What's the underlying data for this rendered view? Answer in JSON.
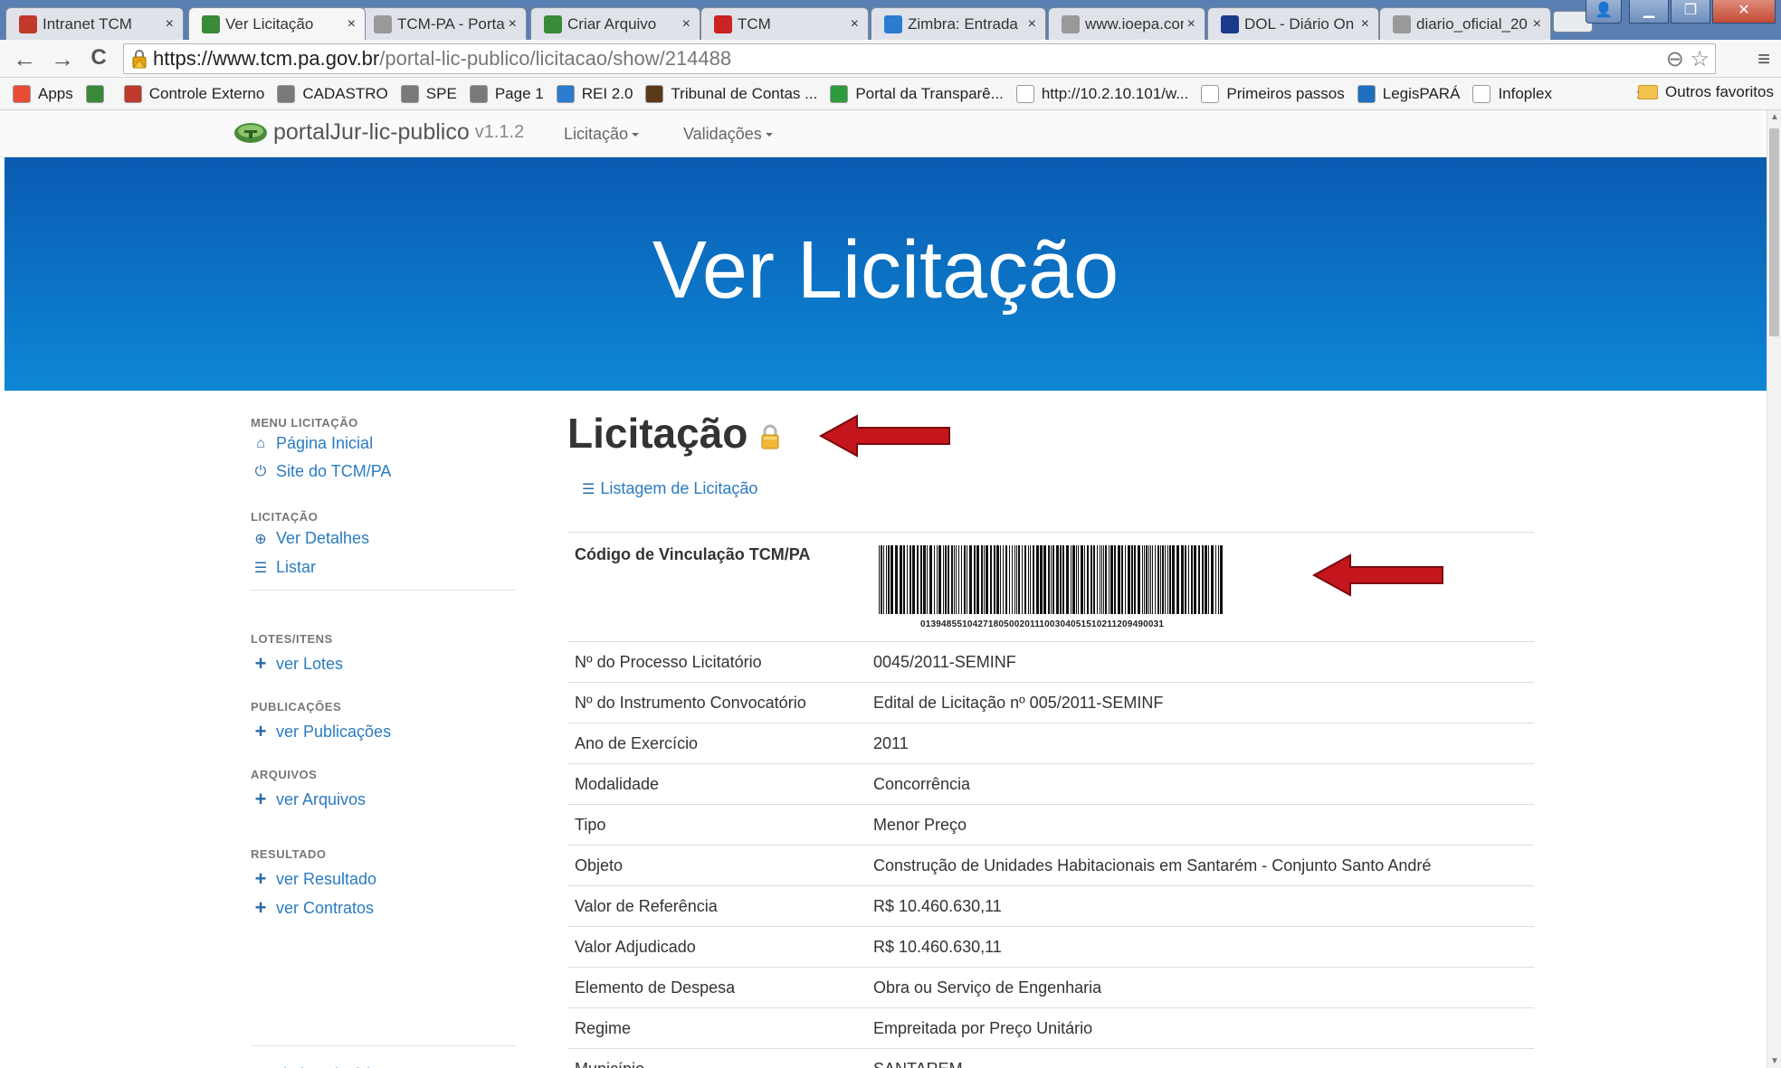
{
  "tabs": [
    {
      "title": "Intranet TCM",
      "icon": "tcm-icon",
      "color": "#c0392b"
    },
    {
      "title": "Ver Licitação",
      "icon": "portaljur-icon",
      "color": "#3a8a3a",
      "active": true
    },
    {
      "title": "TCM-PA - Porta",
      "icon": "page-icon",
      "color": "#999999"
    },
    {
      "title": "Criar Arquivo",
      "icon": "portaljur-icon",
      "color": "#3a8a3a"
    },
    {
      "title": "TCM",
      "icon": "tcm-logo-icon",
      "color": "#cc2222"
    },
    {
      "title": "Zimbra: Entrada",
      "icon": "zimbra-icon",
      "color": "#2b7bd0"
    },
    {
      "title": "www.ioepa.com",
      "icon": "page-icon",
      "color": "#999999"
    },
    {
      "title": "DOL - Diário On",
      "icon": "dol-icon",
      "color": "#1a3b8a"
    },
    {
      "title": "diario_oficial_20",
      "icon": "page-icon",
      "color": "#999999"
    }
  ],
  "tab_close": "×",
  "toolbar": {
    "back": "←",
    "forward": "→",
    "reload": "C",
    "url_host": "https://www.tcm.pa.gov.br",
    "url_path": "/portal-lic-publico/licitacao/show/214488",
    "zoom_icon": "⊖",
    "star_icon": "☆",
    "menu_icon": "≡"
  },
  "bookmarks": [
    {
      "label": "Apps",
      "icon": "apps-grid-icon"
    },
    {
      "label": "",
      "icon": "portaljur-icon"
    },
    {
      "label": "Controle Externo",
      "icon": "tcm-icon"
    },
    {
      "label": "CADASTRO",
      "icon": "chart-icon"
    },
    {
      "label": "SPE",
      "icon": "chart-icon"
    },
    {
      "label": "Page 1",
      "icon": "chart-icon"
    },
    {
      "label": "REI 2.0",
      "icon": "rei-icon"
    },
    {
      "label": "Tribunal de Contas ...",
      "icon": "tribunal-icon"
    },
    {
      "label": "Portal da Transparê...",
      "icon": "flag-icon"
    },
    {
      "label": "http://10.2.10.101/w...",
      "icon": "page-icon"
    },
    {
      "label": "Primeiros passos",
      "icon": "page-icon"
    },
    {
      "label": "LegisPARÁ",
      "icon": "legis-icon"
    },
    {
      "label": "Infoplex",
      "icon": "page-icon"
    }
  ],
  "bookmarks_more": "»",
  "bookmarks_other": "Outros favoritos",
  "app": {
    "brand": "portalJur-lic-publico",
    "version": "v1.1.2",
    "nav": [
      "Licitação",
      "Validações"
    ]
  },
  "hero_title": "Ver Licitação",
  "sidebar": {
    "sections": [
      {
        "title": "MENU LICITAÇÃO",
        "items": [
          {
            "label": "Página Inicial",
            "icon": "home-icon",
            "glyph": "⌂"
          },
          {
            "label": "Site do TCM/PA",
            "icon": "power-icon",
            "glyph": "⏻"
          }
        ]
      },
      {
        "title": "LICITAÇÃO",
        "items": [
          {
            "label": "Ver Detalhes",
            "icon": "zoom-in-icon",
            "glyph": "⊕"
          },
          {
            "label": "Listar",
            "icon": "list-icon",
            "glyph": "☰"
          }
        ]
      },
      {
        "title": "LOTES/ITENS",
        "items": [
          {
            "label": "ver Lotes",
            "icon": "plus-icon",
            "glyph": "+"
          }
        ]
      },
      {
        "title": "PUBLICAÇÕES",
        "items": [
          {
            "label": "ver Publicações",
            "icon": "plus-icon",
            "glyph": "+"
          }
        ]
      },
      {
        "title": "ARQUIVOS",
        "items": [
          {
            "label": "ver Arquivos",
            "icon": "plus-icon",
            "glyph": "+"
          }
        ]
      },
      {
        "title": "RESULTADO",
        "items": [
          {
            "label": "ver Resultado",
            "icon": "plus-icon",
            "glyph": "+"
          },
          {
            "label": "ver Contratos",
            "icon": "plus-icon",
            "glyph": "+"
          }
        ]
      }
    ],
    "print_link": "Imprimir Relatório"
  },
  "content": {
    "heading": "Licitação",
    "list_link": "Listagem de Licitação",
    "code_label": "Código de Vinculação TCM/PA",
    "barcode_number": "01394855104271805002011100304051510211209490031",
    "rows": [
      {
        "label": "Nº do Processo Licitatório",
        "value": "0045/2011-SEMINF"
      },
      {
        "label": "Nº do Instrumento Convocatório",
        "value": "Edital de Licitação nº 005/2011-SEMINF"
      },
      {
        "label": "Ano de Exercício",
        "value": "2011"
      },
      {
        "label": "Modalidade",
        "value": "Concorrência"
      },
      {
        "label": "Tipo",
        "value": "Menor Preço"
      },
      {
        "label": "Objeto",
        "value": "Construção de Unidades Habitacionais em Santarém - Conjunto Santo André"
      },
      {
        "label": "Valor de Referência",
        "value": "R$ 10.460.630,11"
      },
      {
        "label": "Valor Adjudicado",
        "value": "R$ 10.460.630,11"
      },
      {
        "label": "Elemento de Despesa",
        "value": "Obra ou Serviço de Engenharia"
      },
      {
        "label": "Regime",
        "value": "Empreitada por Preço Unitário"
      },
      {
        "label": "Município",
        "value": "SANTAREM"
      }
    ]
  },
  "colors": {
    "link": "#2a7bc1",
    "hero_top": "#0a5bb2",
    "hero_bottom": "#0d87d4",
    "arrow": "#c4161c"
  }
}
